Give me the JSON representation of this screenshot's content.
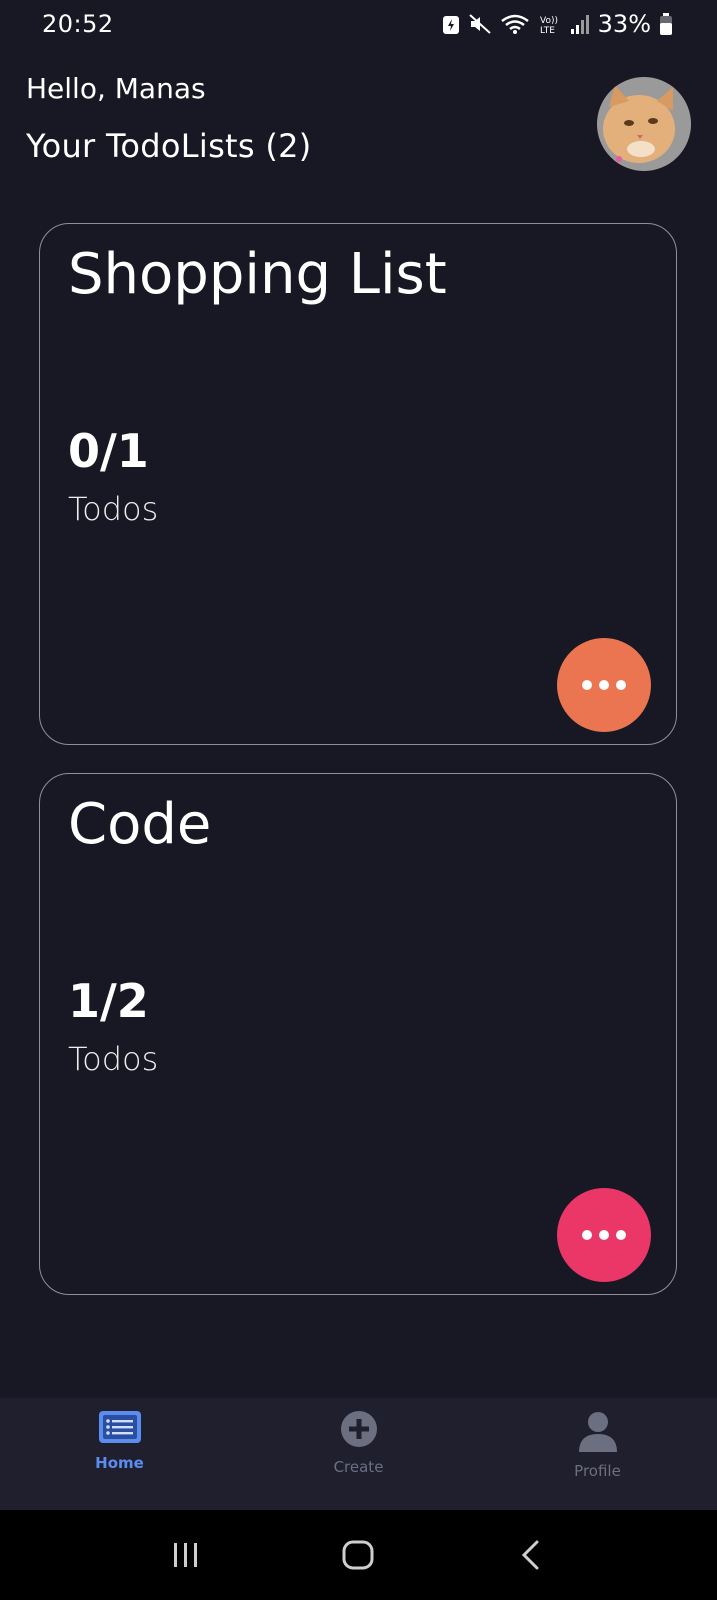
{
  "status_bar": {
    "time": "20:52",
    "battery_percent": "33%",
    "icons": [
      "battery-saver-icon",
      "mute-icon",
      "wifi-icon",
      "volte-icon",
      "signal-icon",
      "battery-icon"
    ]
  },
  "header": {
    "greeting": "Hello, Manas",
    "subtitle": "Your TodoLists (2)"
  },
  "todo_lists": [
    {
      "title": "Shopping List",
      "count": "0/1",
      "count_label": "Todos",
      "button_color": "#ea7550"
    },
    {
      "title": "Code",
      "count": "1/2",
      "count_label": "Todos",
      "button_color": "#ea3768"
    }
  ],
  "bottom_nav": {
    "items": [
      {
        "label": "Home",
        "icon": "list-icon",
        "active": true
      },
      {
        "label": "Create",
        "icon": "plus-circle-icon",
        "active": false
      },
      {
        "label": "Profile",
        "icon": "person-icon",
        "active": false
      }
    ]
  },
  "colors": {
    "background": "#181824",
    "accent": "#5b8def",
    "card_border": "#8f8f99"
  }
}
